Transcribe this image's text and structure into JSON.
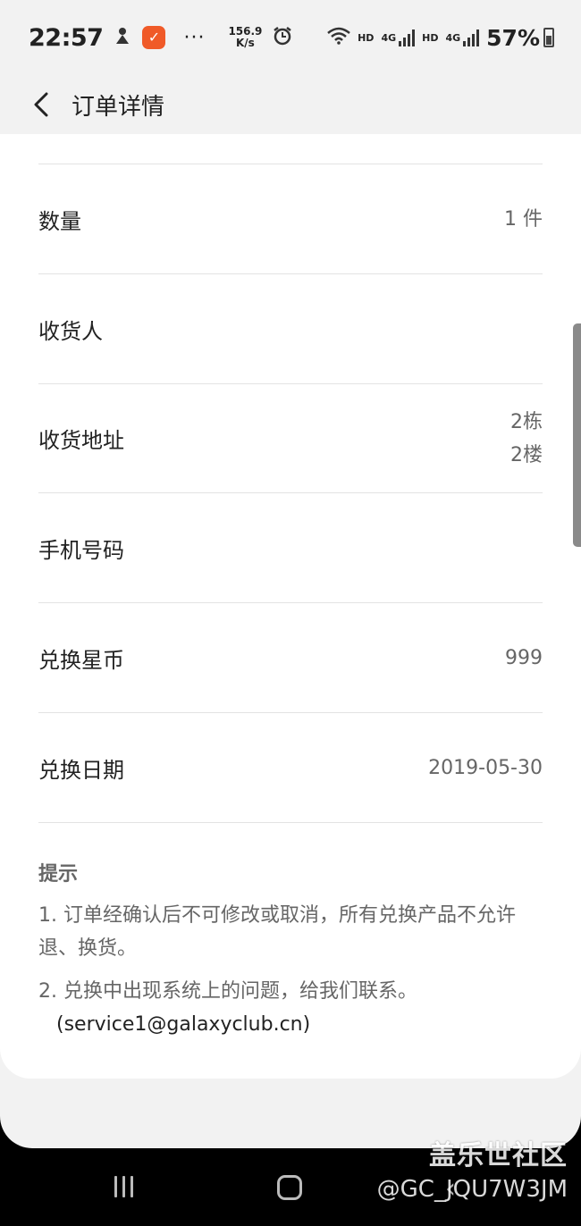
{
  "status_bar": {
    "time": "22:57",
    "speed_value": "156.9",
    "speed_unit": "K/s",
    "hd1": "HD",
    "net1": "4G",
    "hd2": "HD",
    "net2": "4G",
    "battery": "57%"
  },
  "header": {
    "title": "订单详情"
  },
  "rows": [
    {
      "label": "数量",
      "value": "1 件"
    },
    {
      "label": "收货人",
      "value": ""
    },
    {
      "label": "收货地址",
      "value_line1": "2栋",
      "value_line2": "2楼"
    },
    {
      "label": "手机号码",
      "value": ""
    },
    {
      "label": "兑换星币",
      "value": "999"
    },
    {
      "label": "兑换日期",
      "value": "2019-05-30"
    }
  ],
  "tips": {
    "title": "提示",
    "tip1": "1. 订单经确认后不可修改或取消，所有兑换产品不允许退、换货。",
    "tip2": "2. 兑换中出现系统上的问题，给我们联系。",
    "email": "(service1@galaxyclub.cn)"
  },
  "watermark": {
    "site": "盖乐世社区",
    "user": "@GC_JQU7W3JM"
  }
}
